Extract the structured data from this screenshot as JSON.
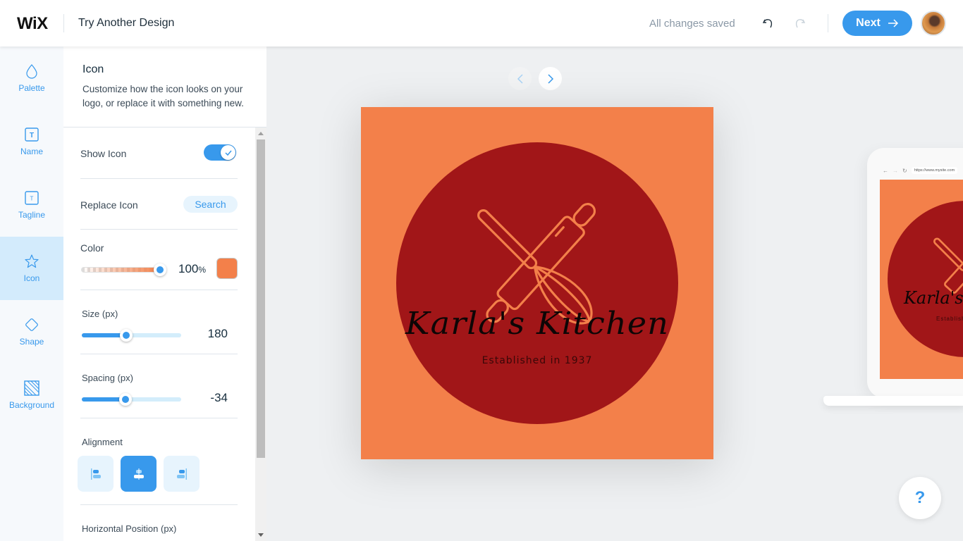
{
  "header": {
    "brand": "WiX",
    "title": "Try Another Design",
    "save_status": "All changes saved",
    "next_label": "Next",
    "undo_icon": "undo-icon",
    "redo_icon": "redo-icon"
  },
  "sidebar": {
    "items": [
      {
        "label": "Palette",
        "icon": "drop-icon",
        "active": false
      },
      {
        "label": "Name",
        "icon": "text-box-icon",
        "active": false
      },
      {
        "label": "Tagline",
        "icon": "text-box-small-icon",
        "active": false
      },
      {
        "label": "Icon",
        "icon": "star-icon",
        "active": true
      },
      {
        "label": "Shape",
        "icon": "diamond-icon",
        "active": false
      },
      {
        "label": "Background",
        "icon": "hatched-square-icon",
        "active": false
      }
    ]
  },
  "panel": {
    "title": "Icon",
    "description": "Customize how the icon looks on your logo, or replace it with something new.",
    "show_icon": {
      "label": "Show Icon",
      "checked": true
    },
    "replace_icon": {
      "label": "Replace Icon",
      "button": "Search"
    },
    "color": {
      "label": "Color",
      "opacity_value": "100",
      "opacity_unit": "%",
      "opacity_fraction": 1.0,
      "swatch": "#f3804a"
    },
    "size": {
      "label": "Size (px)",
      "value": "180",
      "fraction": 0.45
    },
    "spacing": {
      "label": "Spacing (px)",
      "value": "-34",
      "fraction": 0.44
    },
    "alignment": {
      "label": "Alignment",
      "options": [
        "left",
        "center",
        "right"
      ],
      "selected": "center"
    },
    "horizontal_position": {
      "label": "Horizontal Position (px)"
    }
  },
  "canvas": {
    "logo": {
      "name": "Karla's Kitchen",
      "tagline": "Established in 1937",
      "background_color": "#f3804a",
      "shape_color": "#a11618",
      "icon_color": "#f3804a",
      "icon": "rolling-pin-whisk-icon"
    },
    "preview_url": "https://www.mysite.com",
    "help_label": "?"
  },
  "colors": {
    "accent": "#3899ec",
    "accent_light": "#e7f4fd"
  }
}
